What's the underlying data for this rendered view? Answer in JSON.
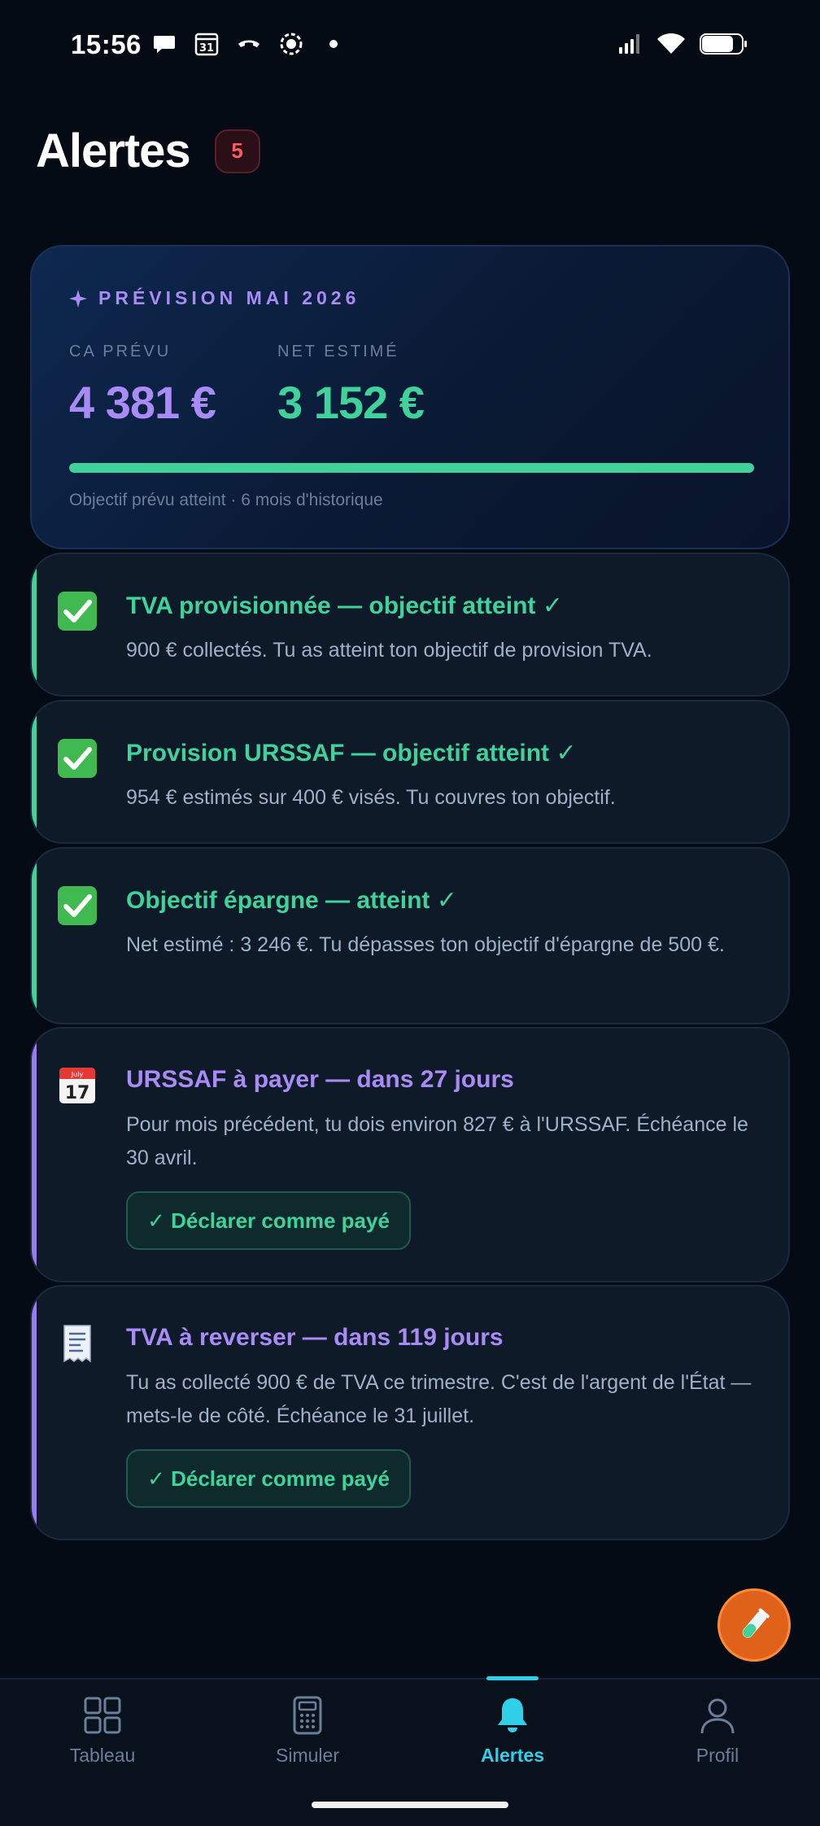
{
  "status_bar": {
    "time": "15:56",
    "left_icons": [
      "chat-bubble-icon",
      "calendar-31-icon",
      "call-icon",
      "record-icon",
      "dot-icon"
    ],
    "right_icons": [
      "signal-icon",
      "wifi-icon",
      "battery-icon"
    ]
  },
  "header": {
    "title": "Alertes",
    "badge_count": "5",
    "badge_color": "#ff5a66"
  },
  "forecast": {
    "title": "PRÉVISION MAI 2026",
    "title_icon": "sparkle-icon",
    "ca_label": "CA PRÉVU",
    "ca_value": "4 381 €",
    "net_label": "NET ESTIMÉ",
    "net_value": "3 152 €",
    "progress": 1.0,
    "footer": "Objectif prévu atteint · 6 mois d'historique"
  },
  "alerts": [
    {
      "type": "success",
      "icon": "check-box-icon",
      "title": "TVA provisionnée — objectif atteint ✓",
      "body": "900 € collectés. Tu as atteint ton objectif de provision TVA."
    },
    {
      "type": "success",
      "icon": "check-box-icon",
      "title": "Provision URSSAF — objectif atteint ✓",
      "body": "954 € estimés sur 400 € visés. Tu couvres ton objectif."
    },
    {
      "type": "success",
      "icon": "check-box-icon",
      "title": "Objectif épargne — atteint ✓",
      "body": "Net estimé : 3 246 €. Tu dépasses ton objectif d'épargne de 500 €."
    },
    {
      "type": "due",
      "icon": "calendar-icon",
      "title": "URSSAF à payer — dans 27 jours",
      "body": "Pour mois précédent, tu dois environ 827 € à l'URSSAF. Échéance le 30 avril.",
      "button": "✓ Déclarer comme payé"
    },
    {
      "type": "due",
      "icon": "receipt-icon",
      "title": "TVA à reverser — dans 119 jours",
      "body": "Tu as collecté 900 € de TVA ce trimestre. C'est de l'argent de l'État — mets-le de côté. Échéance le 31 juillet.",
      "button": "✓ Déclarer comme payé"
    }
  ],
  "fab": {
    "icon": "test-tube-icon"
  },
  "nav": {
    "items": [
      {
        "label": "Tableau",
        "icon": "grid-icon",
        "active": false
      },
      {
        "label": "Simuler",
        "icon": "calculator-icon",
        "active": false
      },
      {
        "label": "Alertes",
        "icon": "bell-icon",
        "active": true
      },
      {
        "label": "Profil",
        "icon": "user-icon",
        "active": false
      }
    ]
  },
  "colors": {
    "background": "#050b14",
    "green": "#3fd29a",
    "purple": "#a98bf5",
    "active_nav": "#2fd0e8"
  }
}
